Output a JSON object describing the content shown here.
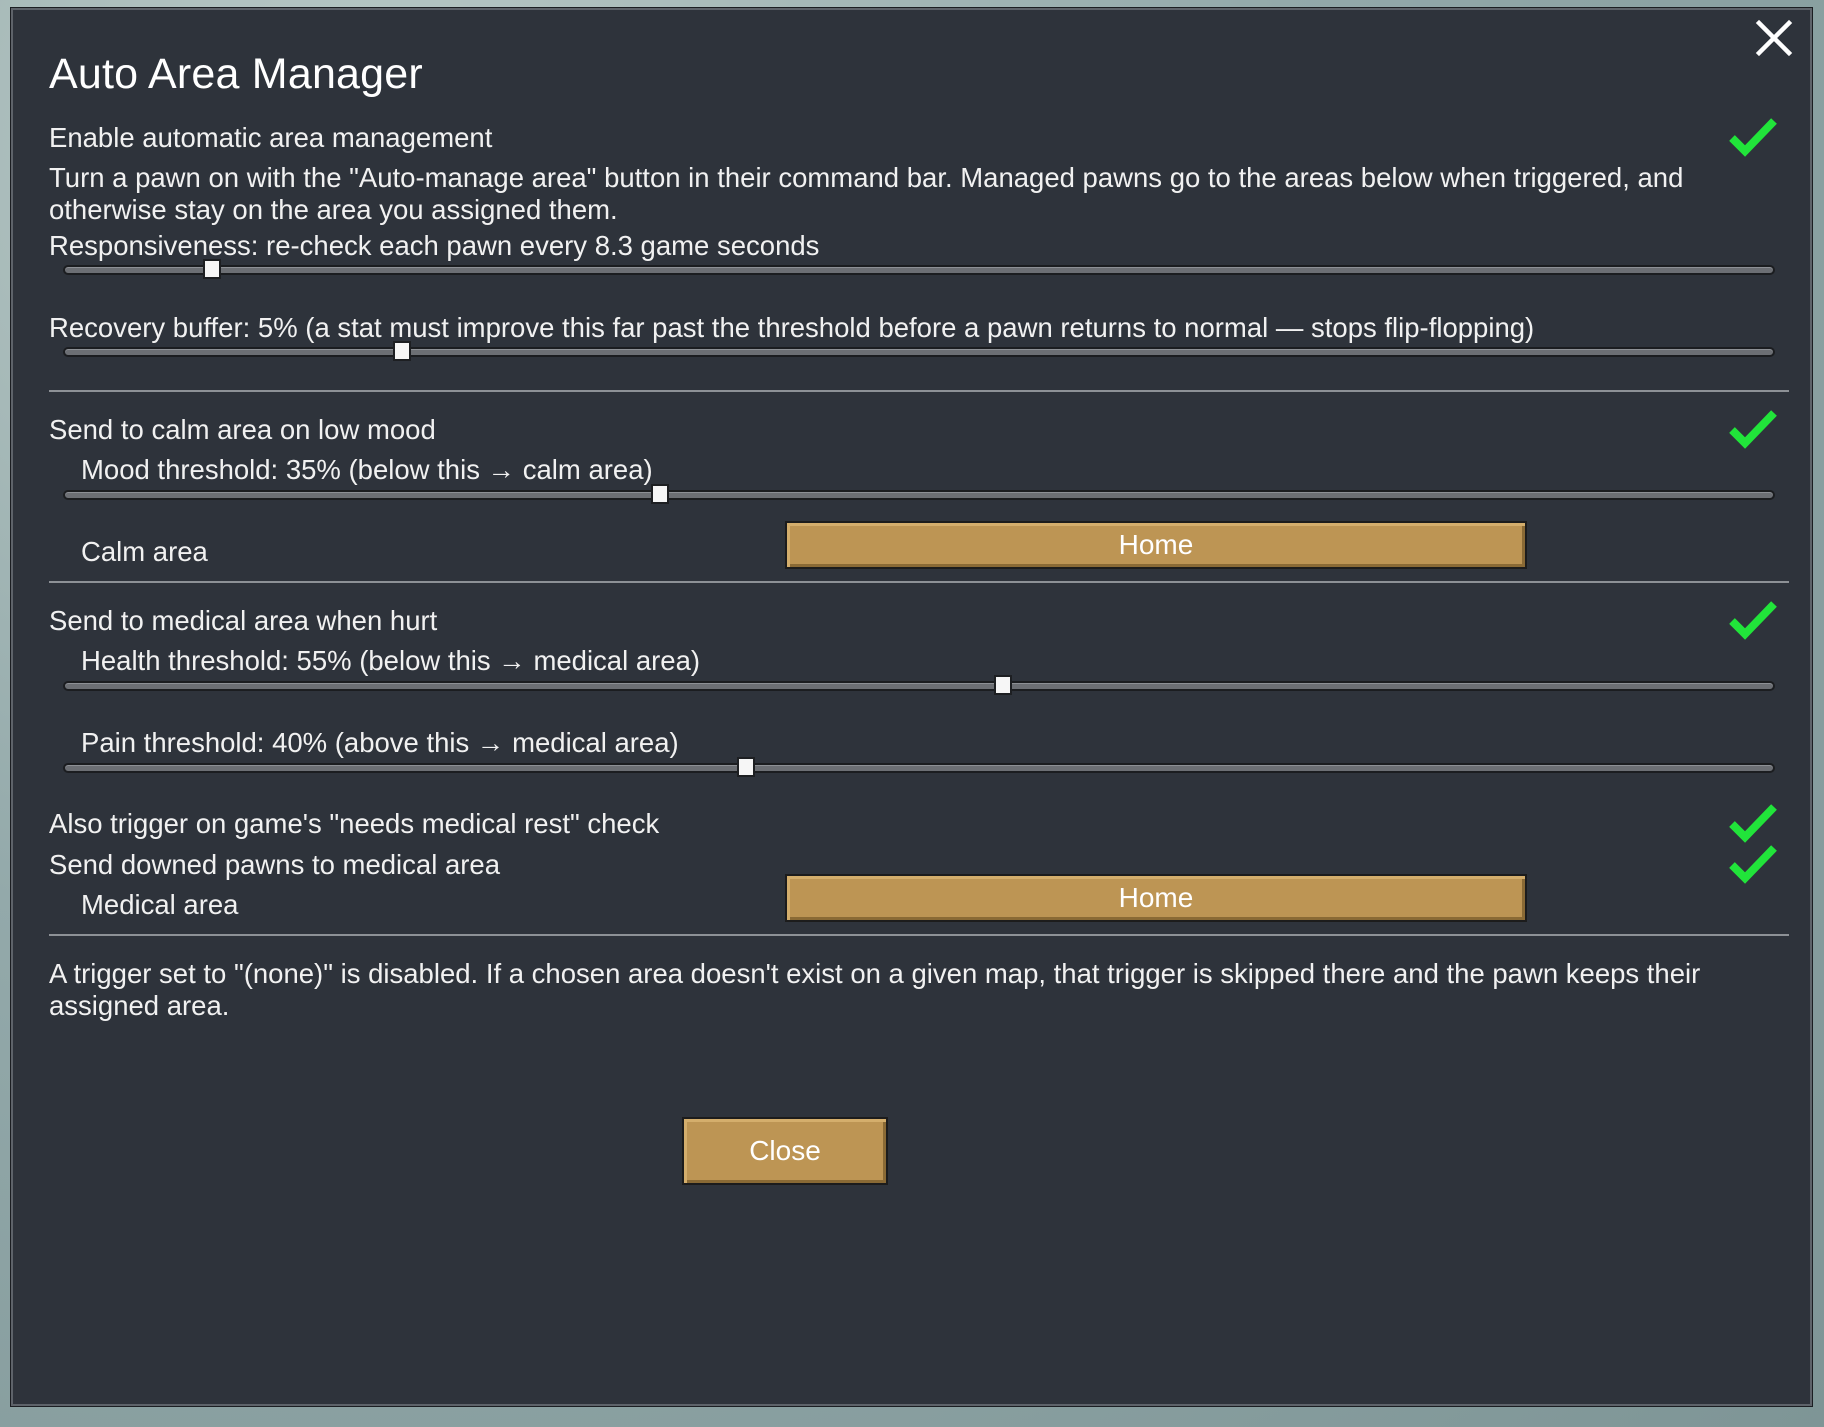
{
  "window": {
    "title": "Auto Area Manager"
  },
  "general": {
    "enable_label": "Enable automatic area management",
    "enable_checked": true,
    "description": "Turn a pawn on with the \"Auto-manage area\" button in their command bar. Managed pawns go to the areas below when triggered, and otherwise stay on the area you assigned them.",
    "responsiveness_label": "Responsiveness: re-check each pawn every 8.3 game seconds",
    "responsiveness_fraction": 0.087,
    "recovery_label": "Recovery buffer: 5%  (a stat must improve this far past the threshold before a pawn returns to normal — stops flip-flopping)",
    "recovery_fraction": 0.198
  },
  "mood": {
    "enable_label": "Send to calm area on low mood",
    "enable_checked": true,
    "threshold_label": "Mood threshold: 35%  (below this → calm area)",
    "threshold_fraction": 0.349,
    "area_label": "Calm area",
    "area_value": "Home"
  },
  "medical": {
    "enable_label": "Send to medical area when hurt",
    "enable_checked": true,
    "health_label": "Health threshold: 55%  (below this → medical area)",
    "health_fraction": 0.549,
    "pain_label": "Pain threshold: 40%  (above this → medical area)",
    "pain_fraction": 0.399,
    "rest_label": "Also trigger on game's \"needs medical rest\" check",
    "rest_checked": true,
    "downed_label": "Send downed pawns to medical area",
    "downed_checked": true,
    "area_label": "Medical area",
    "area_value": "Home"
  },
  "footer": {
    "note": "A trigger set to \"(none)\" is disabled. If a chosen area doesn't exist on a given map, that trigger is skipped there and the pawn keeps their assigned area.",
    "close_label": "Close"
  },
  "colors": {
    "panel": "#2e333b",
    "check": "#21e43a",
    "button": "#bd9554"
  }
}
